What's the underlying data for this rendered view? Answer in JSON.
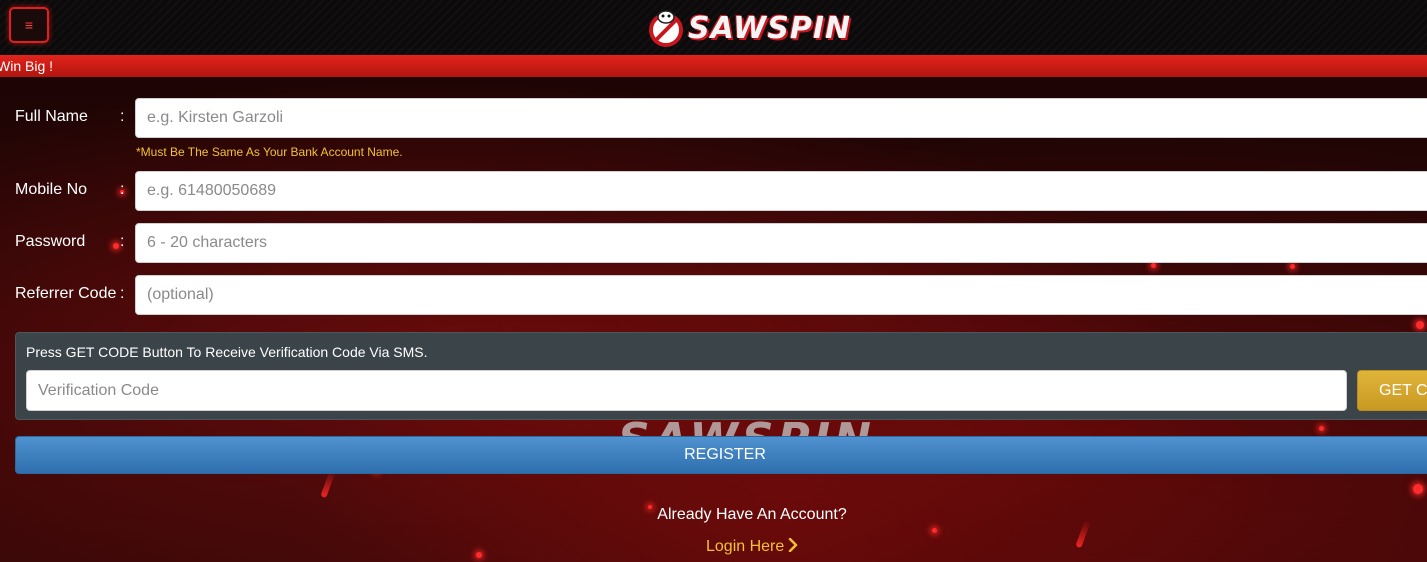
{
  "header": {
    "menu_icon": "hamburger-icon",
    "logo_text": "SAWSPIN"
  },
  "marquee": {
    "text": "Win Big !"
  },
  "form": {
    "full_name": {
      "label": "Full Name",
      "colon": ":",
      "placeholder": "e.g. Kirsten Garzoli",
      "value": "",
      "hint": "*Must Be The Same As Your Bank Account Name."
    },
    "mobile": {
      "label": "Mobile No",
      "colon": ":",
      "placeholder": "e.g. 61480050689",
      "value": ""
    },
    "password": {
      "label": "Password",
      "colon": ":",
      "placeholder": "6 - 20 characters",
      "value": ""
    },
    "referrer": {
      "label": "Referrer Code",
      "colon": ":",
      "placeholder": "(optional)",
      "value": ""
    }
  },
  "verification": {
    "instruction": "Press GET CODE Button To Receive Verification Code Via SMS.",
    "placeholder": "Verification Code",
    "value": "",
    "get_code_label": "GET CODE"
  },
  "register_label": "REGISTER",
  "footer": {
    "already_text": "Already Have An Account?",
    "login_label": "Login Here",
    "login_icon": "chevron-right-icon"
  },
  "colors": {
    "accent_red": "#e1241c",
    "gold": "#f2c230",
    "register_blue": "#3a7fbf",
    "get_code_gold": "#d6a830"
  }
}
